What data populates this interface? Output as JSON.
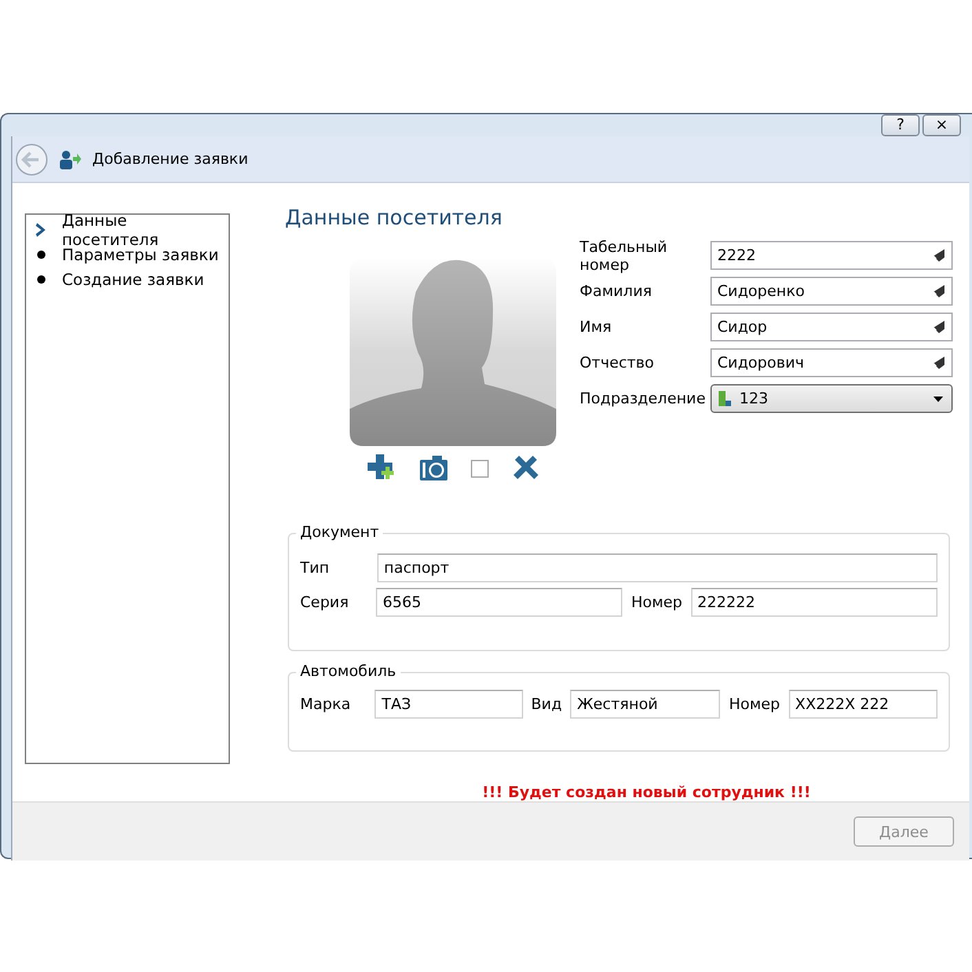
{
  "window": {
    "title_buttons": [
      "?",
      "×"
    ],
    "header_title": "Добавление заявки"
  },
  "steps": [
    {
      "label": "Данные посетителя",
      "selected": true
    },
    {
      "label": "Параметры заявки",
      "selected": false
    },
    {
      "label": "Создание заявки",
      "selected": false
    }
  ],
  "section_title": "Данные посетителя",
  "photo_tools": {
    "checked": false
  },
  "person_fields": [
    {
      "kind": "text",
      "label": "Табельный номер",
      "value": "2222"
    },
    {
      "kind": "text",
      "label": "Фамилия",
      "value": "Сидоренко"
    },
    {
      "kind": "text",
      "label": "Имя",
      "value": "Сидор"
    },
    {
      "kind": "text",
      "label": "Отчество",
      "value": "Сидорович"
    },
    {
      "kind": "dropdown",
      "label": "Подразделение",
      "value": "123"
    }
  ],
  "document": {
    "title": "Документ",
    "type_label": "Тип",
    "type_value": "паспорт",
    "series_label": "Серия",
    "series_value": "6565",
    "number_label": "Номер",
    "number_value": "222222"
  },
  "car": {
    "title": "Автомобиль",
    "make_label": "Марка",
    "make_value": "ТАЗ",
    "kind_label": "Вид",
    "kind_value": "Жестяной",
    "number_label": "Номер",
    "number_value": "XX222X 222"
  },
  "warning": "!!! Будет создан новый сотрудник !!!",
  "next_button": {
    "label": "Далее",
    "disabled": true
  }
}
